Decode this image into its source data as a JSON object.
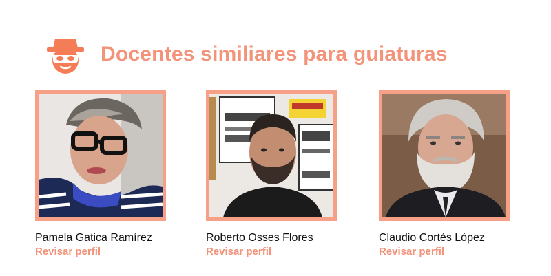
{
  "header": {
    "title": "Docentes similiares para guiaturas",
    "logo_icon": "incognito-mask-icon"
  },
  "accent_color": "#f2937a",
  "teachers": [
    {
      "name": "Pamela Gatica Ramírez",
      "link_label": "Revisar perfil",
      "photo": "portrait-woman-glasses"
    },
    {
      "name": "Roberto Osses Flores",
      "link_label": "Revisar perfil",
      "photo": "portrait-man-beard-lettering-wall"
    },
    {
      "name": "Claudio Cortés López",
      "link_label": "Revisar perfil",
      "photo": "portrait-older-man-white-beard"
    }
  ]
}
